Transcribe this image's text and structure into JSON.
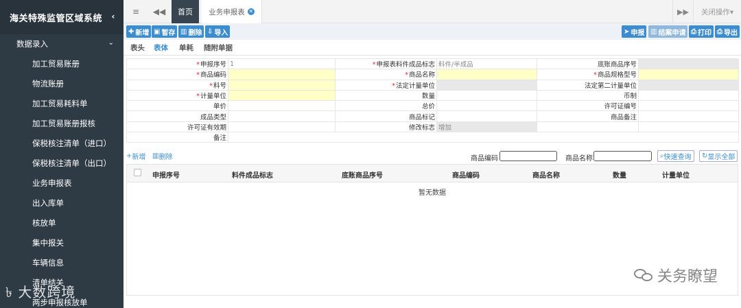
{
  "sidebar": {
    "title": "海关特殊监管区域系统",
    "group": "数据录入",
    "items": [
      "加工贸易账册",
      "物流账册",
      "加工贸易耗料单",
      "加工贸易账册报核",
      "保税核注清单（进口）",
      "保税核注清单（出口）",
      "业务申报表",
      "出入库单",
      "核放单",
      "集中报关",
      "车辆信息",
      "清单结关",
      "两步申报核放单"
    ],
    "watermark": "大数跨境"
  },
  "tabs": {
    "home": "首页",
    "active": "业务申报表",
    "close_ops": "关闭操作▾"
  },
  "toolbar": {
    "add": "新增",
    "save_draft": "暂存",
    "delete": "删除",
    "import": "导入",
    "declare": "申报",
    "close_apply": "结案申请",
    "print": "打印",
    "export": "导出"
  },
  "subtabs": [
    "表头",
    "表体",
    "单耗",
    "随附单据"
  ],
  "form": {
    "r1": {
      "l1": "申报序号",
      "v1": "1",
      "l2": "申报表料件成品标志",
      "v2": "料件/半成品",
      "l3": "底账商品序号"
    },
    "r2": {
      "l1": "商品编码",
      "l2": "商品名称",
      "l3": "商品规格型号"
    },
    "r3": {
      "l1": "料号",
      "l2": "法定计量单位",
      "l3": "法定第二计量单位"
    },
    "r4": {
      "l1": "计量单位",
      "l2": "数量",
      "l3": "币制"
    },
    "r5": {
      "l1": "单价",
      "l2": "总价",
      "l3": "许可证编号"
    },
    "r6": {
      "l1": "成品类型",
      "l2": "商品标记",
      "l3": "商品备注"
    },
    "r7": {
      "l1": "许可证有效期",
      "l2": "修改标志",
      "v2": "增加"
    },
    "r8": {
      "l1": "备注"
    }
  },
  "grid_bar": {
    "add": "新增",
    "delete": "删除",
    "code_label": "商品编码",
    "name_label": "商品名称",
    "quick_search": "快速查询",
    "show_all": "显示全部"
  },
  "grid": {
    "columns": [
      "申报序号",
      "料件成品标志",
      "底账商品序号",
      "商品编码",
      "商品名称",
      "数量",
      "计量单位"
    ],
    "empty_text": "暂无数据"
  },
  "watermark_right": "关务瞭望"
}
